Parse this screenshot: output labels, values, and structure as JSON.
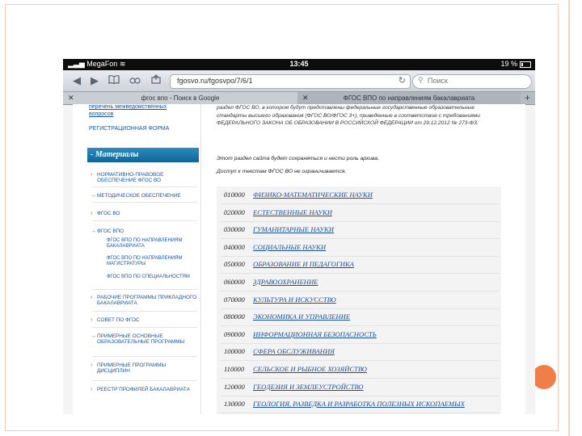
{
  "statusbar": {
    "carrier": "MegaFon",
    "time": "13:45",
    "battery": "19 %"
  },
  "toolbar": {
    "back_label": "◀",
    "forward_label": "▶",
    "bookmarks_label": "📖",
    "share_label": "↗"
  },
  "url": {
    "value": "fgosvo.ru/fgosvpo/7/6/1",
    "reload_icon": "↻"
  },
  "search": {
    "placeholder": "Поиск",
    "icon": "search-icon"
  },
  "tabs": [
    {
      "label": "фгос впо - Поиск в Google",
      "close": "✕"
    },
    {
      "label": "ФГОС ВПО по направлениям бакалавриата",
      "close": "✕"
    }
  ],
  "tab_add": "+",
  "sidebar": {
    "top_link_line1": "перечень межведомственных",
    "top_link_line2": "вопросов",
    "registration": "РЕГИСТРАЦИОННАЯ ФОРМА",
    "section_header": "- Материалы",
    "items": [
      {
        "label": "НОРМАТИВНО-ПРАВОВОЕ ОБЕСПЕЧЕНИЕ ФГОС ВО"
      },
      {
        "label": "МЕТОДИЧЕСКОЕ ОБЕСПЕЧЕНИЕ"
      },
      {
        "label": "ФГОС ВО"
      },
      {
        "label": "ФГОС ВПО"
      }
    ],
    "subitems": [
      {
        "label": "ФГОС ВПО ПО НАПРАВЛЕНИЯМ БАКАЛАВРИАТА"
      },
      {
        "label": "ФГОС ВПО ПО НАПРАВЛЕНИЯМ МАГИСТРАТУРЫ"
      },
      {
        "label": "ФГОС ВПО ПО СПЕЦИАЛЬНОСТЯМ"
      }
    ],
    "items2": [
      {
        "label": "РАБОЧИЕ ПРОГРАММЫ ПРИКЛАДНОГО БАКАЛАВРИАТА"
      },
      {
        "label": "СОВЕТ ПО ФГОС"
      },
      {
        "label": "ПРИМЕРНЫЕ ОСНОВНЫЕ ОБРАЗОВАТЕЛЬНЫЕ ПРОГРАММЫ"
      },
      {
        "label": "ПРИМЕРНЫЕ ПРОГРАММЫ ДИСЦИПЛИН"
      },
      {
        "label": "РЕЕСТР ПРОФИЛЕЙ БАКАЛАВРИАТА"
      }
    ]
  },
  "main": {
    "intro": "раздел ФГОС ВО, в котором будут представлены федеральные государственные образовательные стандарты высшего образования (ФГОС ВО/ФГОС 3+), приведенные в соответствие с требованиями ФЕДЕРАЛЬНОГО ЗАКОНА ОБ ОБРАЗОВАНИИ В РОССИЙСКОЙ ФЕДЕРАЦИИ от 29.12.2012 № 273-ФЗ.",
    "note1": "Этот раздел сайта будет сохраняться и нести роль архива.",
    "note2": "Доступ к текстам ФГОС ВО не ограничивается.",
    "directions": [
      {
        "code": "010000",
        "name": "ФИЗИКО-МАТЕМАТИЧЕСКИЕ НАУКИ"
      },
      {
        "code": "020000",
        "name": "ЕСТЕСТВЕННЫЕ НАУКИ"
      },
      {
        "code": "030000",
        "name": "ГУМАНИТАРНЫЕ НАУКИ"
      },
      {
        "code": "040000",
        "name": "СОЦИАЛЬНЫЕ НАУКИ"
      },
      {
        "code": "050000",
        "name": "ОБРАЗОВАНИЕ И ПЕДАГОГИКА"
      },
      {
        "code": "060000",
        "name": "ЗДРАВООХРАНЕНИЕ"
      },
      {
        "code": "070000",
        "name": "КУЛЬТУРА И ИСКУССТВО"
      },
      {
        "code": "080000",
        "name": "ЭКОНОМИКА И УПРАВЛЕНИЕ"
      },
      {
        "code": "090000",
        "name": "ИНФОРМАЦИОННАЯ БЕЗОПАСНОСТЬ"
      },
      {
        "code": "100000",
        "name": "СФЕРА ОБСЛУЖИВАНИЯ"
      },
      {
        "code": "110000",
        "name": "СЕЛЬСКОЕ И РЫБНОЕ ХОЗЯЙСТВО"
      },
      {
        "code": "120000",
        "name": "ГЕОДЕЗИЯ И ЗЕМЛЕУСТРОЙСТВО"
      },
      {
        "code": "130000",
        "name": "ГЕОЛОГИЯ, РАЗВЕДКА И РАЗРАБОТКА ПОЛЕЗНЫХ ИСКОПАЕМЫХ"
      }
    ]
  },
  "colors": {
    "accent": "#f07e48",
    "link": "#1c4f96",
    "header_bar": "#0f6496"
  }
}
